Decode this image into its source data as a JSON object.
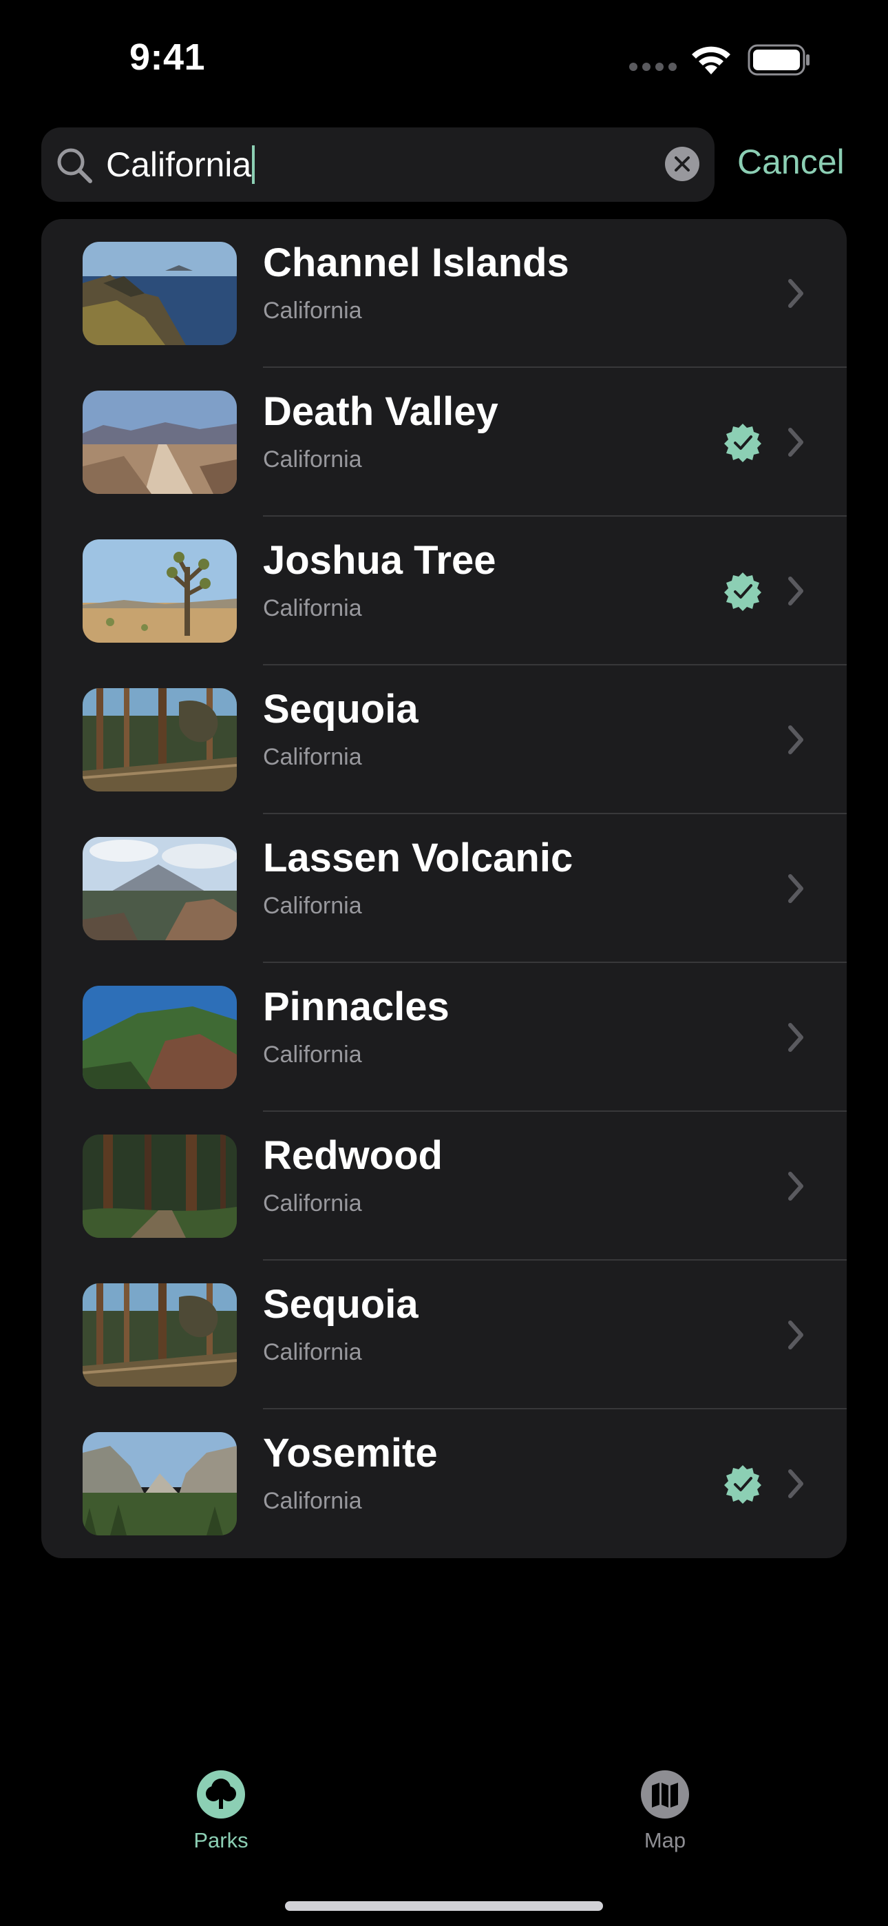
{
  "status_bar": {
    "time": "9:41"
  },
  "search": {
    "query": "California",
    "cancel_label": "Cancel"
  },
  "results": [
    {
      "name": "Channel Islands",
      "state": "California",
      "visited": false,
      "thumb": "channel-islands"
    },
    {
      "name": "Death Valley",
      "state": "California",
      "visited": true,
      "thumb": "death-valley"
    },
    {
      "name": "Joshua Tree",
      "state": "California",
      "visited": true,
      "thumb": "joshua-tree"
    },
    {
      "name": "Sequoia",
      "state": "California",
      "visited": false,
      "thumb": "forest"
    },
    {
      "name": "Lassen Volcanic",
      "state": "California",
      "visited": false,
      "thumb": "lassen"
    },
    {
      "name": "Pinnacles",
      "state": "California",
      "visited": false,
      "thumb": "pinnacles"
    },
    {
      "name": "Redwood",
      "state": "California",
      "visited": false,
      "thumb": "redwood"
    },
    {
      "name": "Sequoia",
      "state": "California",
      "visited": false,
      "thumb": "forest"
    },
    {
      "name": "Yosemite",
      "state": "California",
      "visited": true,
      "thumb": "yosemite"
    }
  ],
  "tabs": [
    {
      "label": "Parks",
      "icon": "tree-icon",
      "selected": true
    },
    {
      "label": "Map",
      "icon": "map-icon",
      "selected": false
    }
  ],
  "colors": {
    "accent": "#8ccfb4",
    "card": "#1c1c1e",
    "secondary_text": "#98989d",
    "inactive_tab": "#8e8e93"
  }
}
